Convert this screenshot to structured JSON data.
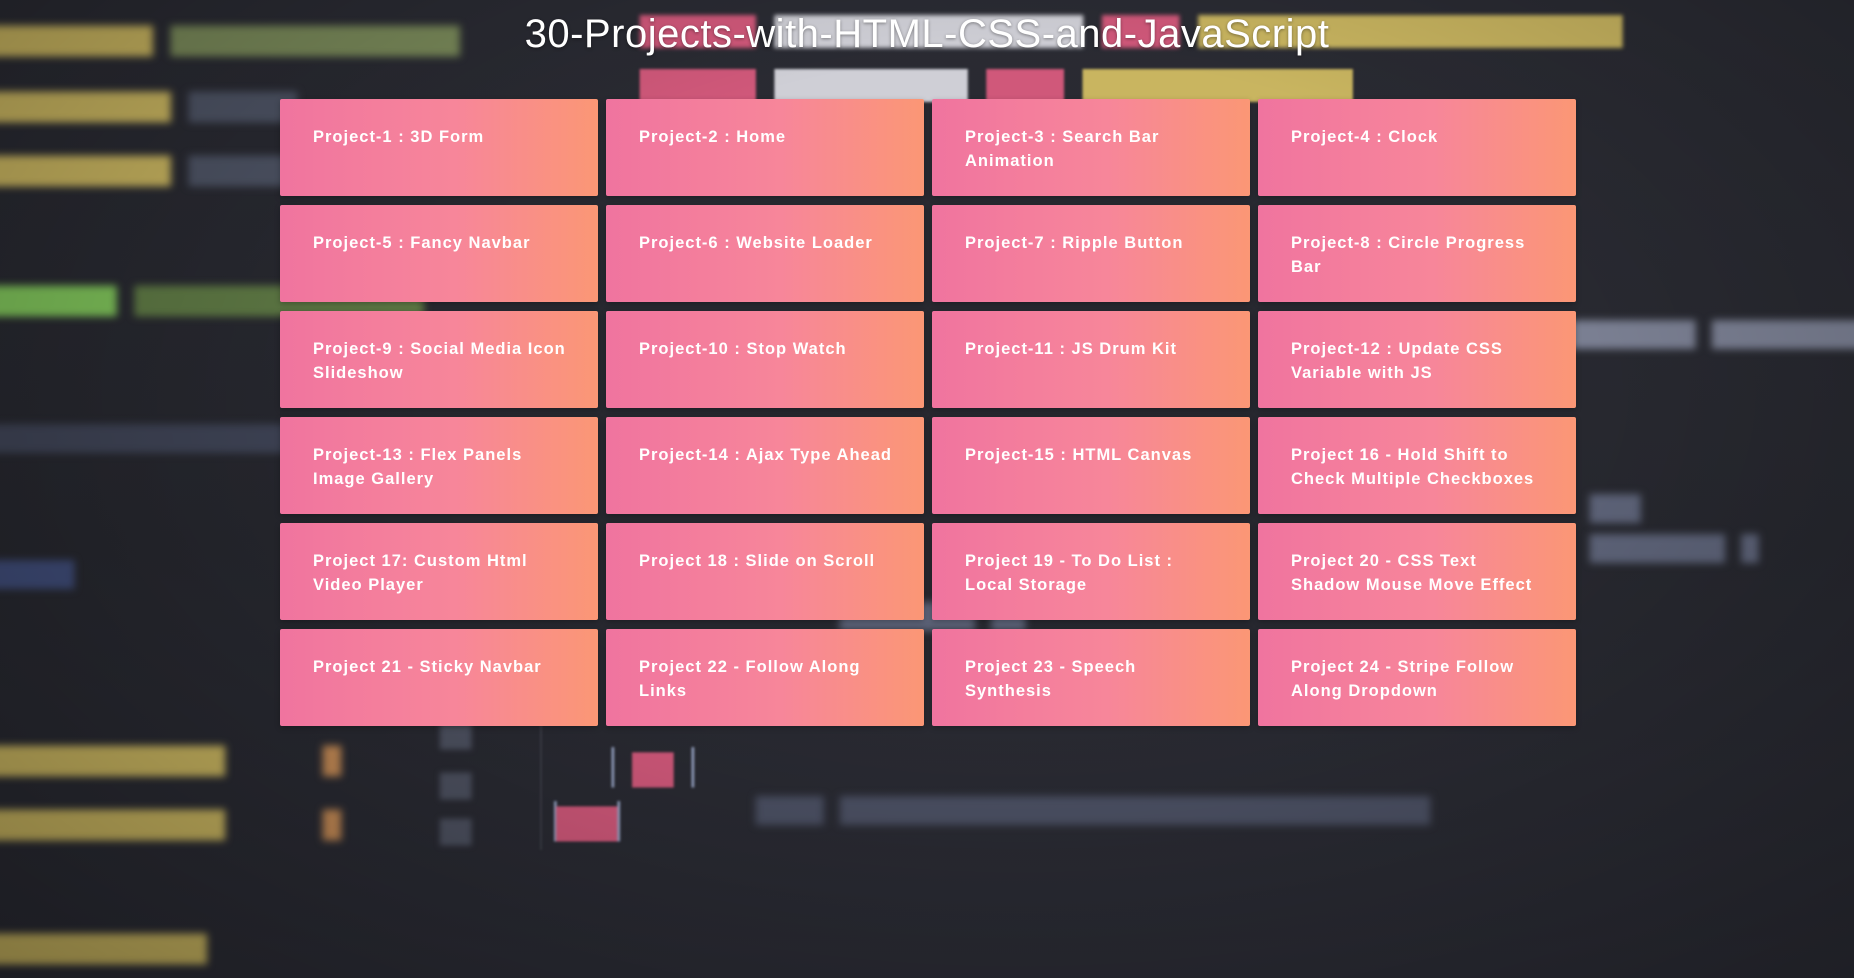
{
  "page": {
    "title": "30-Projects-with-HTML-CSS-and-JavaScript"
  },
  "projects": [
    {
      "label": "Project-1 : 3D Form"
    },
    {
      "label": "Project-2 : Home"
    },
    {
      "label": "Project-3 : Search Bar Animation"
    },
    {
      "label": "Project-4 : Clock"
    },
    {
      "label": "Project-5 : Fancy Navbar"
    },
    {
      "label": "Project-6 : Website Loader"
    },
    {
      "label": "Project-7 : Ripple Button"
    },
    {
      "label": "Project-8 : Circle Progress Bar"
    },
    {
      "label": "Project-9 : Social Media Icon Slideshow"
    },
    {
      "label": "Project-10 : Stop Watch"
    },
    {
      "label": "Project-11 : JS Drum Kit"
    },
    {
      "label": "Project-12 : Update CSS Variable with JS"
    },
    {
      "label": "Project-13 : Flex Panels Image Gallery"
    },
    {
      "label": "Project-14 : Ajax Type Ahead"
    },
    {
      "label": "Project-15 : HTML Canvas"
    },
    {
      "label": "Project 16 - Hold Shift to Check Multiple Checkboxes"
    },
    {
      "label": "Project 17: Custom Html Video Player"
    },
    {
      "label": "Project 18 : Slide on Scroll"
    },
    {
      "label": "Project 19 - To Do List : Local Storage"
    },
    {
      "label": "Project 20 - CSS Text Shadow Mouse Move Effect"
    },
    {
      "label": "Project 21 - Sticky Navbar"
    },
    {
      "label": "Project 22 - Follow Along Links"
    },
    {
      "label": "Project 23 - Speech Synthesis"
    },
    {
      "label": "Project 24 - Stripe Follow Along Dropdown"
    }
  ],
  "theme": {
    "card_gradient_start": "#f0749f",
    "card_gradient_end": "#fb9775",
    "background": "#24252c",
    "title_color": "#ffffff"
  }
}
